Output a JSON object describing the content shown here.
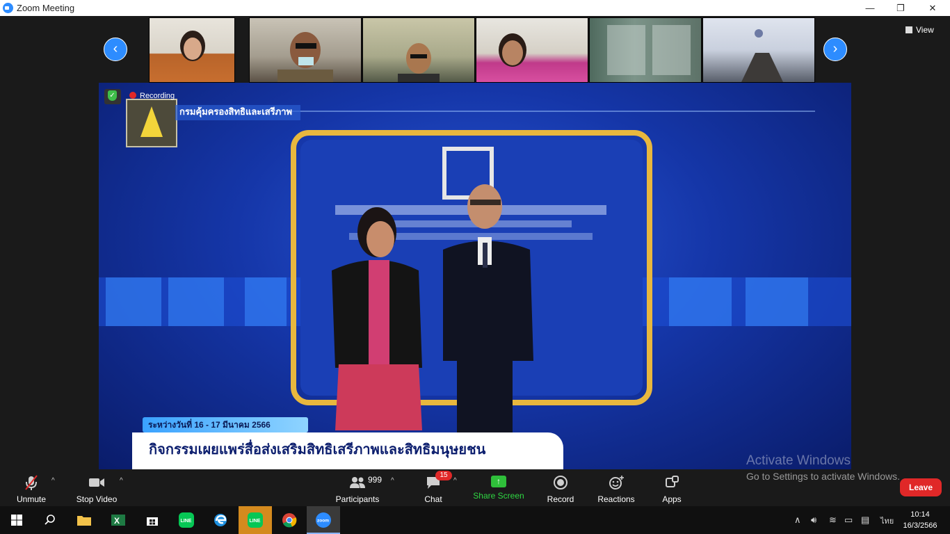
{
  "window": {
    "title": "Zoom Meeting",
    "minimize": "—",
    "restore": "❐",
    "close": "✕"
  },
  "gallery": {
    "prev": "‹",
    "next": "›",
    "view_label": "View"
  },
  "share": {
    "recording_label": "Recording",
    "org_name": "กรมคุ้มครองสิทธิและเสรีภาพ",
    "date_text": "ระหว่างวันที่ 16 - 17 มีนาคม 2566",
    "event_title": "กิจกรรมเผยแพร่สื่อส่งเสริมสิทธิเสรีภาพและสิทธิมนุษยชน"
  },
  "toolbar": {
    "unmute": "Unmute",
    "stop_video": "Stop Video",
    "participants": "Participants",
    "participants_count": "999",
    "chat": "Chat",
    "chat_badge": "15",
    "share_screen": "Share Screen",
    "record": "Record",
    "reactions": "Reactions",
    "apps": "Apps",
    "leave": "Leave"
  },
  "watermark": {
    "line1": "Activate Windows",
    "line2": "Go to Settings to activate Windows."
  },
  "taskbar": {
    "lang": "ไทย",
    "time": "10:14",
    "date": "16/3/2566",
    "line_label": "LINE",
    "zoom_label": "zoom"
  },
  "colors": {
    "accent": "#2d8cff",
    "leave": "#e02828",
    "share_green": "#2fbf3a"
  }
}
